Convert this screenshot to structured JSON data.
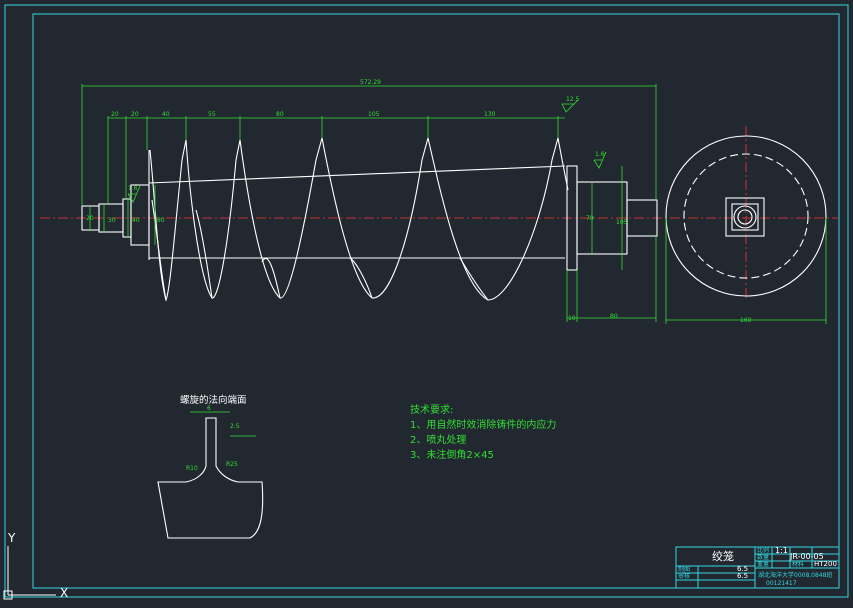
{
  "drawing": {
    "overall_length_dim": "572.29",
    "pitch_dims": [
      "20",
      "20",
      "40",
      "55",
      "80",
      "105",
      "130"
    ],
    "dia_dims_left": [
      "30",
      "40",
      "80",
      "20"
    ],
    "dia_dims_right": [
      "70",
      "105"
    ],
    "right_bottom_dims": [
      "10",
      "80"
    ],
    "end_view_dim": "160",
    "roughness_left": "1.6",
    "roughness_right_top": "12.5",
    "roughness_right": "1.6",
    "section_roughness": "2.5"
  },
  "section": {
    "title": "螺旋的法向端面",
    "dim_top": "6",
    "dim_r1": "R10",
    "dim_r2": "R25"
  },
  "tech": {
    "title": "技术要求:",
    "lines": [
      "1、用自然时效消除铸件的内应力",
      "2、喷丸处理",
      "3、未注倒角2×45"
    ]
  },
  "title_block": {
    "part_name": "绞笼",
    "scale_label": "比例",
    "scale": "1:1",
    "quantity_label": "数量",
    "code": "JR-00-05",
    "weight_label": "重量",
    "material_label": "材料",
    "material": "HT200",
    "drawn_label": "制图",
    "checked_label": "审核",
    "date1": "6.5",
    "date2": "6.5",
    "school": "湖北海洋大学0008,0848班",
    "student_no": "00121417"
  },
  "ucs": {
    "y": "Y",
    "x": "X"
  }
}
